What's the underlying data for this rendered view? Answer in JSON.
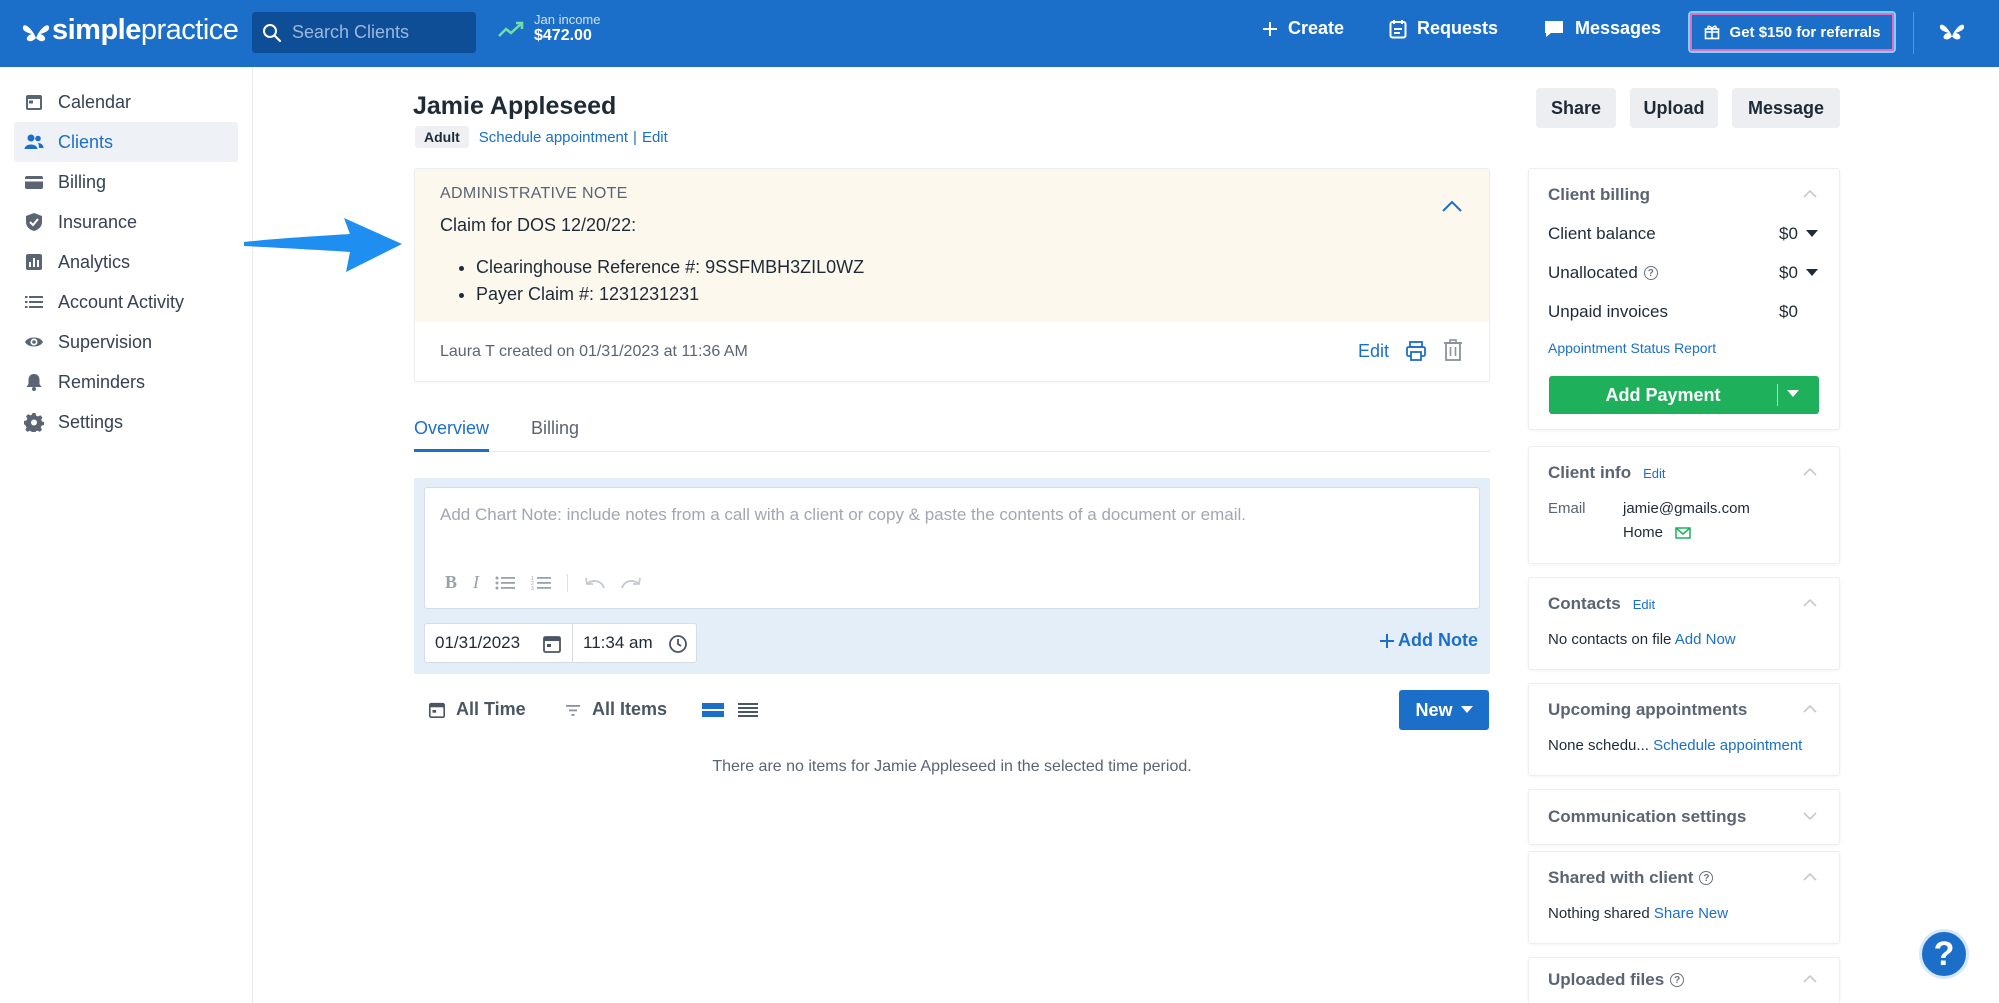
{
  "topbar": {
    "logo_bold": "simple",
    "logo_light": "practice",
    "search_placeholder": "Search Clients",
    "income_label": "Jan income",
    "income_value": "$472.00",
    "create": "Create",
    "requests": "Requests",
    "messages": "Messages",
    "referral": "Get $150 for referrals"
  },
  "sidebar": {
    "items": [
      {
        "label": "Calendar",
        "icon": "calendar-icon"
      },
      {
        "label": "Clients",
        "icon": "users-icon",
        "active": true
      },
      {
        "label": "Billing",
        "icon": "credit-card-icon"
      },
      {
        "label": "Insurance",
        "icon": "shield-icon"
      },
      {
        "label": "Analytics",
        "icon": "bar-chart-icon"
      },
      {
        "label": "Account Activity",
        "icon": "list-icon"
      },
      {
        "label": "Supervision",
        "icon": "eye-icon"
      },
      {
        "label": "Reminders",
        "icon": "bell-icon"
      },
      {
        "label": "Settings",
        "icon": "gear-icon"
      }
    ]
  },
  "client": {
    "name": "Jamie Appleseed",
    "badge": "Adult",
    "schedule_link": "Schedule appointment",
    "sep": "|",
    "edit_link": "Edit"
  },
  "actions": {
    "share": "Share",
    "upload": "Upload",
    "message": "Message"
  },
  "admin_note": {
    "title": "ADMINISTRATIVE NOTE",
    "claim": "Claim for DOS 12/20/22:",
    "items": [
      "Clearinghouse Reference #: 9SSFMBH3ZIL0WZ",
      "Payer Claim #: 1231231231"
    ],
    "footer": "Laura T created on 01/31/2023 at 11:36 AM",
    "edit": "Edit"
  },
  "tabs": {
    "overview": "Overview",
    "billing": "Billing"
  },
  "chart_note": {
    "placeholder": "Add Chart Note: include notes from a call with a client or copy & paste the contents of a document or email.",
    "date": "01/31/2023",
    "time": "11:34 am",
    "add_note": "Add Note"
  },
  "filters": {
    "time": "All Time",
    "items": "All Items",
    "new": "New"
  },
  "empty_message": "There are no items for Jamie Appleseed in the selected time period.",
  "right": {
    "billing": {
      "title": "Client billing",
      "balance_label": "Client balance",
      "balance_value": "$0",
      "unallocated_label": "Unallocated",
      "unallocated_value": "$0",
      "unpaid_label": "Unpaid invoices",
      "unpaid_value": "$0",
      "report_link": "Appointment Status Report",
      "add_payment": "Add Payment"
    },
    "client_info": {
      "title": "Client info",
      "edit": "Edit",
      "email_label": "Email",
      "email_value": "jamie@gmails.com",
      "email_type": "Home"
    },
    "contacts": {
      "title": "Contacts",
      "edit": "Edit",
      "empty": "No contacts on file",
      "add": "Add Now"
    },
    "upcoming": {
      "title": "Upcoming appointments",
      "empty": "None schedu...",
      "schedule": "Schedule appointment"
    },
    "communication": {
      "title": "Communication settings"
    },
    "shared": {
      "title": "Shared with client",
      "empty": "Nothing shared",
      "share": "Share New"
    },
    "uploaded": {
      "title": "Uploaded files"
    }
  },
  "help": "?",
  "colors": {
    "brand": "#1c6fc9",
    "success": "#1fb05c",
    "note_bg": "#fdf8ee"
  }
}
